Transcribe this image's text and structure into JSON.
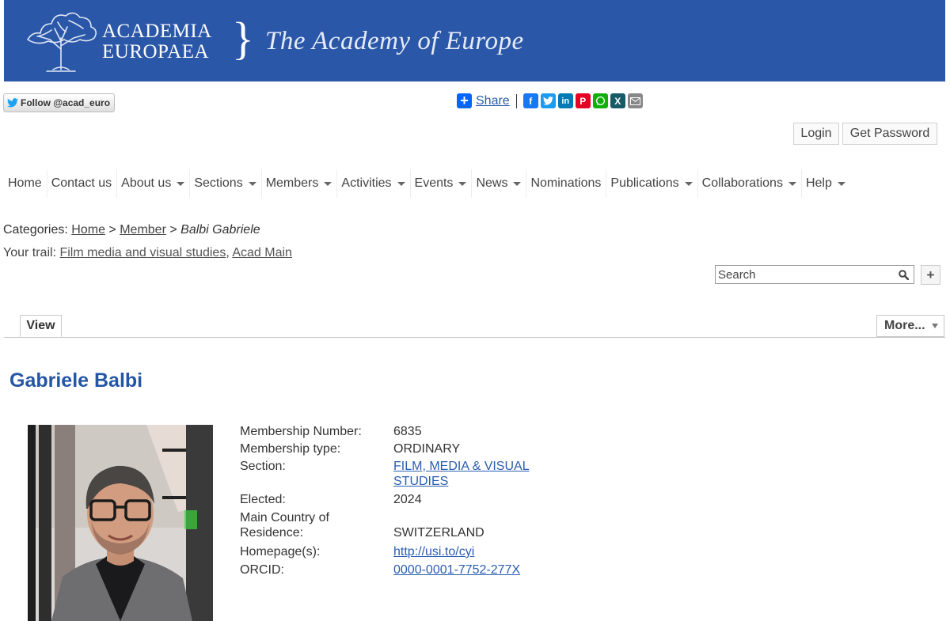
{
  "banner": {
    "logo_line1": "ACADEMIA",
    "logo_line2": "EUROPAEA",
    "tagline": "The Academy of Europe",
    "bg_color": "#2b57a8"
  },
  "social": {
    "follow_label": "Follow @acad_euro",
    "share_label": "Share",
    "icons": [
      "facebook-icon",
      "twitter-icon",
      "linkedin-icon",
      "pinterest-icon",
      "whatsapp-icon",
      "xing-icon",
      "email-icon"
    ]
  },
  "auth": {
    "login": "Login",
    "get_password": "Get Password"
  },
  "nav": [
    {
      "label": "Home",
      "dropdown": false
    },
    {
      "label": "Contact us",
      "dropdown": false
    },
    {
      "label": "About us",
      "dropdown": true
    },
    {
      "label": "Sections",
      "dropdown": true
    },
    {
      "label": "Members",
      "dropdown": true
    },
    {
      "label": "Activities",
      "dropdown": true
    },
    {
      "label": "Events",
      "dropdown": true
    },
    {
      "label": "News",
      "dropdown": true
    },
    {
      "label": "Nominations",
      "dropdown": false
    },
    {
      "label": "Publications",
      "dropdown": true
    },
    {
      "label": "Collaborations",
      "dropdown": true
    },
    {
      "label": "Help",
      "dropdown": true
    }
  ],
  "breadcrumb": {
    "prefix": "Categories:",
    "home": "Home",
    "sep": ">",
    "member": "Member",
    "current": "Balbi Gabriele"
  },
  "trail": {
    "prefix": "Your trail:",
    "item1": "Film media and visual studies",
    "comma": ",",
    "item2": "Acad Main"
  },
  "search": {
    "placeholder": "Search"
  },
  "tabs": {
    "view": "View",
    "more": "More..."
  },
  "profile": {
    "name": "Gabriele Balbi",
    "fields": [
      {
        "label": "Membership Number:",
        "value": "6835",
        "link": false
      },
      {
        "label": "Membership type:",
        "value": "ORDINARY",
        "link": false
      },
      {
        "label": "Section:",
        "value": "FILM, MEDIA & VISUAL STUDIES",
        "link": true
      },
      {
        "label": "Elected:",
        "value": "2024",
        "link": false
      },
      {
        "label": "Main Country of Residence:",
        "value": "SWITZERLAND",
        "link": false
      },
      {
        "label": "Homepage(s):",
        "value": "http://usi.to/cyi",
        "link": true
      },
      {
        "label": "ORCID:",
        "value": "0000-0001-7752-277X",
        "link": true
      }
    ]
  },
  "colors": {
    "link": "#2a5db0",
    "name": "#2456a4"
  }
}
